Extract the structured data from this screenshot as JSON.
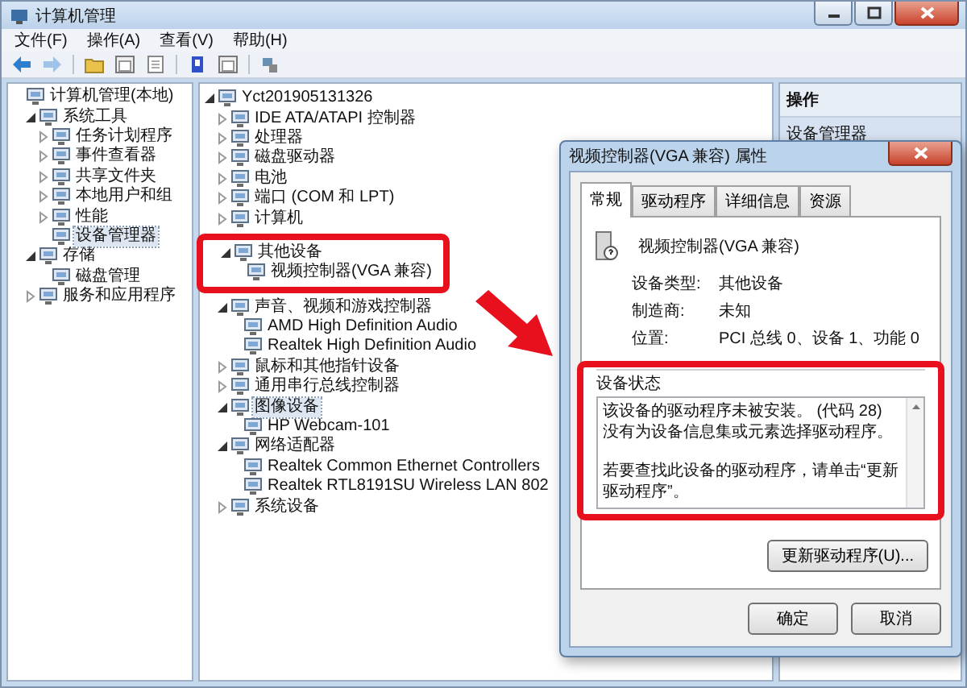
{
  "window": {
    "title": "计算机管理"
  },
  "menu": [
    "文件(F)",
    "操作(A)",
    "查看(V)",
    "帮助(H)"
  ],
  "toolbar": [
    {
      "kind": "back",
      "disabled": false
    },
    {
      "kind": "forward",
      "disabled": true
    },
    {
      "kind": "folder",
      "disabled": false
    },
    {
      "kind": "panel",
      "disabled": false
    },
    {
      "kind": "page",
      "disabled": false
    },
    {
      "kind": "help",
      "disabled": false
    },
    {
      "kind": "panel",
      "disabled": false
    },
    {
      "kind": "device",
      "disabled": false
    }
  ],
  "nav_tree": [
    {
      "label": "计算机管理(本地)",
      "selected": false,
      "children": [
        {
          "label": "系统工具",
          "expanded": true,
          "selected": false,
          "children": [
            {
              "label": "任务计划程序",
              "expanded": false,
              "selected": false
            },
            {
              "label": "事件查看器",
              "expanded": false,
              "selected": false
            },
            {
              "label": "共享文件夹",
              "expanded": false,
              "selected": false
            },
            {
              "label": "本地用户和组",
              "expanded": false,
              "selected": false
            },
            {
              "label": "性能",
              "expanded": false,
              "selected": false
            },
            {
              "label": "设备管理器",
              "selected": true
            }
          ]
        },
        {
          "label": "存储",
          "expanded": true,
          "selected": false,
          "children": [
            {
              "label": "磁盘管理",
              "selected": false
            }
          ]
        },
        {
          "label": "服务和应用程序",
          "expanded": false,
          "selected": false
        }
      ]
    }
  ],
  "device_tree": [
    {
      "label": "Yct201905131326",
      "expanded": true,
      "selected": false,
      "children": [
        {
          "label": "IDE ATA/ATAPI 控制器",
          "expanded": false,
          "selected": false,
          "highlighted": false
        },
        {
          "label": "处理器",
          "expanded": false,
          "selected": false,
          "highlighted": false
        },
        {
          "label": "磁盘驱动器",
          "expanded": false,
          "selected": false,
          "highlighted": false
        },
        {
          "label": "电池",
          "expanded": false,
          "selected": false,
          "highlighted": false
        },
        {
          "label": "端口 (COM 和 LPT)",
          "expanded": false,
          "selected": false,
          "highlighted": false
        },
        {
          "label": "计算机",
          "expanded": false,
          "selected": false,
          "highlighted": false
        },
        {
          "label": "其他设备",
          "expanded": true,
          "selected": false,
          "highlighted": true,
          "children": [
            {
              "label": "视频控制器(VGA 兼容)",
              "selected": false
            }
          ]
        },
        {
          "label": "声音、视频和游戏控制器",
          "expanded": true,
          "selected": false,
          "highlighted": false,
          "children": [
            {
              "label": "AMD High Definition Audio",
              "selected": false
            },
            {
              "label": "Realtek High Definition Audio",
              "selected": false
            }
          ]
        },
        {
          "label": "鼠标和其他指针设备",
          "expanded": false,
          "selected": false,
          "highlighted": false
        },
        {
          "label": "通用串行总线控制器",
          "expanded": false,
          "selected": false,
          "highlighted": false
        },
        {
          "label": "图像设备",
          "expanded": true,
          "selected": true,
          "highlighted": false,
          "children": [
            {
              "label": "HP Webcam-101",
              "selected": false
            }
          ]
        },
        {
          "label": "网络适配器",
          "expanded": true,
          "selected": false,
          "highlighted": false,
          "children": [
            {
              "label": "Realtek Common Ethernet Controllers",
              "selected": false
            },
            {
              "label": "Realtek RTL8191SU Wireless LAN 802",
              "selected": false
            }
          ]
        },
        {
          "label": "系统设备",
          "expanded": false,
          "selected": false,
          "highlighted": false
        }
      ]
    }
  ],
  "actions": {
    "title": "操作",
    "items": [
      {
        "label": "设备管理器",
        "selected": true
      }
    ]
  },
  "dialog": {
    "title": "视频控制器(VGA 兼容) 属性",
    "tabs": [
      {
        "label": "常规",
        "selected": true
      },
      {
        "label": "驱动程序",
        "selected": false
      },
      {
        "label": "详细信息",
        "selected": false
      },
      {
        "label": "资源",
        "selected": false
      }
    ],
    "device_name": "视频控制器(VGA 兼容)",
    "properties": [
      {
        "label": "设备类型:",
        "value": "其他设备"
      },
      {
        "label": "制造商:",
        "value": "未知"
      },
      {
        "label": "位置:",
        "value": "PCI 总线 0、设备 1、功能 0"
      }
    ],
    "status": {
      "title": "设备状态",
      "highlighted": true,
      "paragraphs": [
        [
          "该设备的驱动程序未被安装。 (代码 28)",
          "没有为设备信息集或元素选择驱动程序。"
        ],
        [
          "若要查找此设备的驱动程序，请单击“更新驱动程序”。"
        ]
      ]
    },
    "update_button": "更新驱动程序(U)...",
    "buttons": [
      "确定",
      "取消"
    ]
  },
  "annotations": [
    {
      "kind": "arrow"
    }
  ]
}
